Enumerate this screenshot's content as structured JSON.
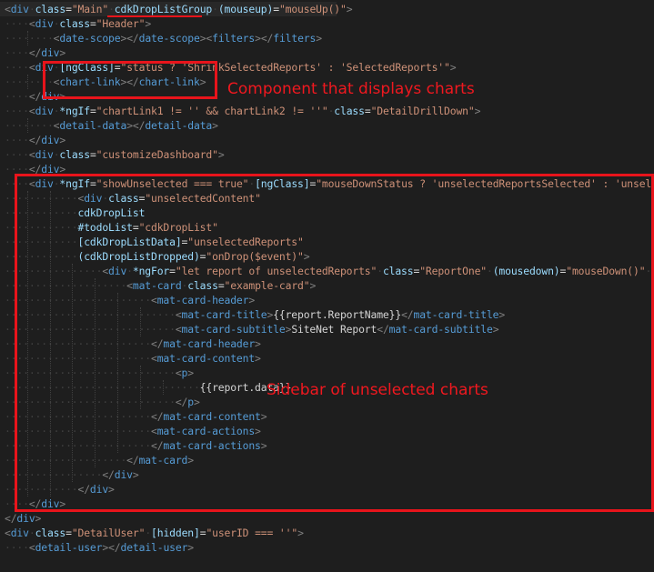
{
  "editor": {
    "lines": [
      "<div class=\"Main\" cdkDropListGroup (mouseup)=\"mouseUp()\">",
      "    <div class=\"Header\">",
      "        <date-scope></date-scope><filters></filters>",
      "    </div>",
      "    <div [ngClass]=\"status ? 'ShrinkSelectedReports' : 'SelectedReports'\">",
      "        <chart-link></chart-link>",
      "    </div>",
      "    <div *ngIf=\"chartLink1 != '' && chartLink2 != ''\" class=\"DetailDrillDown\">",
      "        <detail-data></detail-data>",
      "    </div>",
      "    <div class=\"customizeDashboard\">",
      "    </div>",
      "    <div *ngIf=\"showUnselected === true\" [ngClass]=\"mouseDownStatus ? 'unselectedReportsSelected' : 'unselectedR",
      "            <div class=\"unselectedContent\"",
      "            cdkDropList",
      "            #todoList=\"cdkDropList\"",
      "            [cdkDropListData]=\"unselectedReports\"",
      "            (cdkDropListDropped)=\"onDrop($event)\">",
      "                <div *ngFor=\"let report of unselectedReports\" class=\"ReportOne\" (mousedown)=\"mouseDown()\" cdkDrag>",
      "                    <mat-card class=\"example-card\">",
      "                        <mat-card-header>",
      "                            <mat-card-title>{{report.ReportName}}</mat-card-title>",
      "                            <mat-card-subtitle>SiteNet Report</mat-card-subtitle>",
      "                        </mat-card-header>",
      "                        <mat-card-content>",
      "                            <p>",
      "                                {{report.data}}",
      "                            </p>",
      "                        </mat-card-content>",
      "                        <mat-card-actions>",
      "                        </mat-card-actions>",
      "                    </mat-card>",
      "                </div>",
      "            </div>",
      "    </div>",
      "</div>",
      "<div class=\"DetailUser\" [hidden]=\"userID === ''\">",
      "    <detail-user></detail-user>"
    ]
  },
  "annotations": {
    "component_label": "Component that displays charts",
    "sidebar_label": "Sidebar of unselected charts"
  },
  "colors": {
    "background": "#1e1e1e",
    "tag": "#569cd6",
    "attribute": "#9cdcfe",
    "string": "#ce9178",
    "text": "#d4d4d4",
    "annotation": "#e8141b"
  }
}
